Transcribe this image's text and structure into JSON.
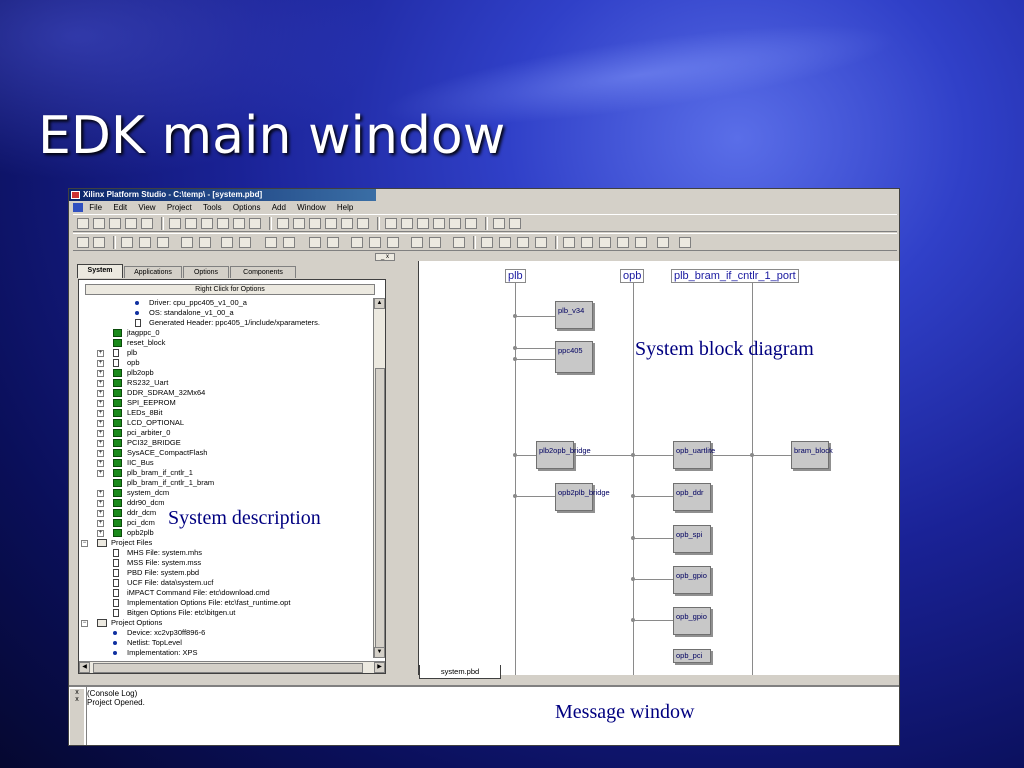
{
  "slide": {
    "title": "EDK main window"
  },
  "app": {
    "title": "Xilinx Platform Studio - C:\\temp\\ - [system.pbd]",
    "menus": [
      "File",
      "Edit",
      "View",
      "Project",
      "Tools",
      "Options",
      "Add",
      "Window",
      "Help"
    ]
  },
  "left_panel": {
    "tabs": [
      "System",
      "Applications",
      "Options",
      "Components"
    ],
    "right_click_hint": "Right Click for Options",
    "tree": [
      {
        "label": "Driver: cpu_ppc405_v1_00_a",
        "icon": "bullet"
      },
      {
        "label": "OS: standalone_v1_00_a",
        "icon": "bullet"
      },
      {
        "label": "Generated Header: ppc405_1/include/xparameters.",
        "icon": "doc"
      },
      {
        "label": "jtagppc_0",
        "icon": "comp"
      },
      {
        "label": "reset_block",
        "icon": "comp"
      },
      {
        "label": "plb",
        "icon": "bus"
      },
      {
        "label": "opb",
        "icon": "bus"
      },
      {
        "label": "plb2opb",
        "icon": "comp"
      },
      {
        "label": "RS232_Uart",
        "icon": "comp"
      },
      {
        "label": "DDR_SDRAM_32Mx64",
        "icon": "comp"
      },
      {
        "label": "SPI_EEPROM",
        "icon": "comp"
      },
      {
        "label": "LEDs_8Bit",
        "icon": "comp"
      },
      {
        "label": "LCD_OPTIONAL",
        "icon": "comp"
      },
      {
        "label": "pci_arbiter_0",
        "icon": "comp"
      },
      {
        "label": "PCI32_BRIDGE",
        "icon": "comp"
      },
      {
        "label": "SysACE_CompactFlash",
        "icon": "comp"
      },
      {
        "label": "IIC_Bus",
        "icon": "comp"
      },
      {
        "label": "plb_bram_if_cntlr_1",
        "icon": "comp"
      },
      {
        "label": "plb_bram_if_cntlr_1_bram",
        "icon": "comp"
      },
      {
        "label": "system_dcm",
        "icon": "comp"
      },
      {
        "label": "ddr90_dcm",
        "icon": "comp"
      },
      {
        "label": "ddr_dcm",
        "icon": "comp"
      },
      {
        "label": "pci_dcm",
        "icon": "comp"
      },
      {
        "label": "opb2plb",
        "icon": "comp"
      },
      {
        "label": "Project Files",
        "icon": "folder"
      },
      {
        "label": "MHS File: system.mhs",
        "icon": "doc"
      },
      {
        "label": "MSS File: system.mss",
        "icon": "doc"
      },
      {
        "label": "PBD File: system.pbd",
        "icon": "doc"
      },
      {
        "label": "UCF File: data\\system.ucf",
        "icon": "doc"
      },
      {
        "label": "iMPACT Command File: etc\\download.cmd",
        "icon": "doc"
      },
      {
        "label": "Implementation Options File: etc\\fast_runtime.opt",
        "icon": "doc"
      },
      {
        "label": "Bitgen Options File: etc\\bitgen.ut",
        "icon": "doc"
      },
      {
        "label": "Project Options",
        "icon": "folder"
      },
      {
        "label": "Device: xc2vp30ff896-6",
        "icon": "bullet"
      },
      {
        "label": "Netlist: TopLevel",
        "icon": "bullet"
      },
      {
        "label": "Implementation: XPS",
        "icon": "bullet"
      }
    ]
  },
  "diagram": {
    "tab_label": "system.pbd",
    "buses": [
      "plb",
      "opb",
      "plb_bram_if_cntlr_1_port"
    ],
    "blocks": [
      {
        "label": "plb_v34"
      },
      {
        "label": "ppc405"
      },
      {
        "label": "plb2opb_bridge"
      },
      {
        "label": "opb2plb_bridge"
      },
      {
        "label": "opb_uartlite"
      },
      {
        "label": "opb_ddr"
      },
      {
        "label": "opb_spi"
      },
      {
        "label": "opb_gpio"
      },
      {
        "label": "opb_gpio"
      },
      {
        "label": "bram_block"
      },
      {
        "label": "opb_pci"
      }
    ]
  },
  "console": {
    "lines": [
      "(Console Log)",
      "Project Opened."
    ]
  },
  "captions": {
    "block_diagram": "System block diagram",
    "system_description": "System description",
    "message_window": "Message window"
  }
}
